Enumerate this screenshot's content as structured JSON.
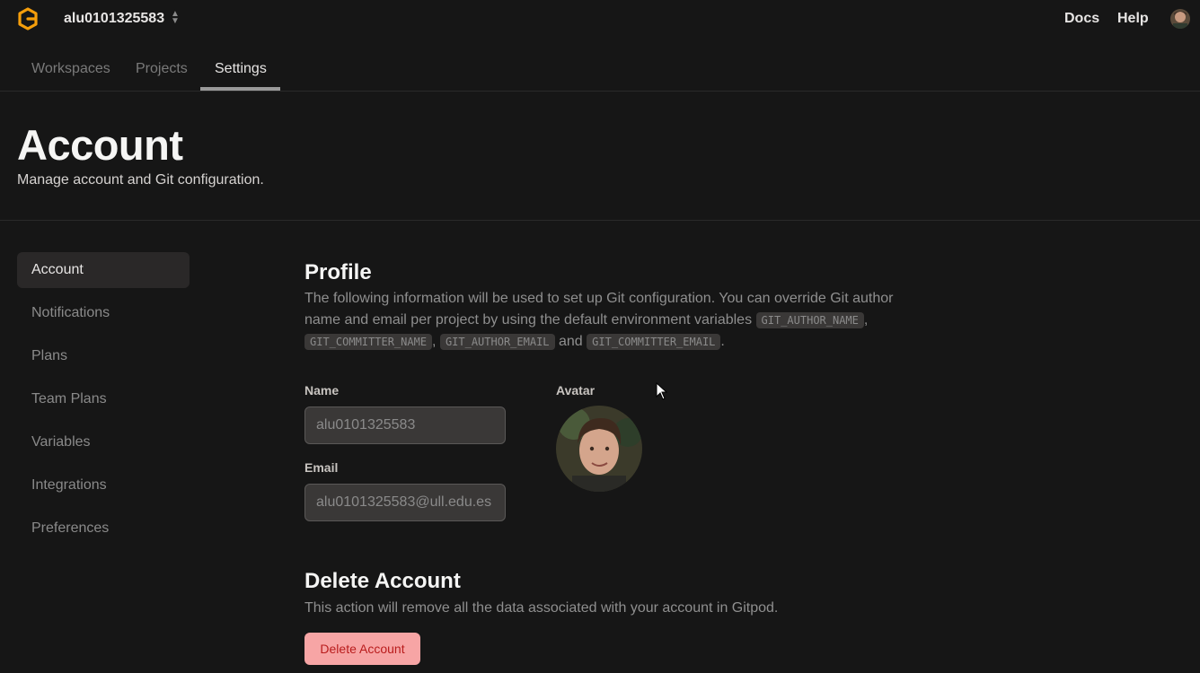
{
  "header": {
    "org_name": "alu0101325583",
    "links": [
      "Docs",
      "Help"
    ]
  },
  "tabs": [
    {
      "label": "Workspaces",
      "active": false
    },
    {
      "label": "Projects",
      "active": false
    },
    {
      "label": "Settings",
      "active": true
    }
  ],
  "page": {
    "title": "Account",
    "subtitle": "Manage account and Git configuration."
  },
  "sidebar": {
    "items": [
      {
        "label": "Account",
        "active": true
      },
      {
        "label": "Notifications",
        "active": false
      },
      {
        "label": "Plans",
        "active": false
      },
      {
        "label": "Team Plans",
        "active": false
      },
      {
        "label": "Variables",
        "active": false
      },
      {
        "label": "Integrations",
        "active": false
      },
      {
        "label": "Preferences",
        "active": false
      }
    ]
  },
  "profile": {
    "title": "Profile",
    "desc_part1": "The following information will be used to set up Git configuration. You can override Git author name and email per project by using the default environment variables",
    "var1": "GIT_AUTHOR_NAME",
    "var2": "GIT_COMMITTER_NAME",
    "var3": "GIT_AUTHOR_EMAIL",
    "and": "and",
    "var4": "GIT_COMMITTER_EMAIL",
    "name_label": "Name",
    "name_value": "alu0101325583",
    "email_label": "Email",
    "email_value": "alu0101325583@ull.edu.es",
    "avatar_label": "Avatar"
  },
  "delete": {
    "title": "Delete Account",
    "desc": "This action will remove all the data associated with your account in Gitpod.",
    "button": "Delete Account"
  },
  "colors": {
    "background": "#161616",
    "logo_orange": "#f59e0b",
    "danger_bg": "#f7a5a5",
    "danger_text": "#b91c1c"
  }
}
